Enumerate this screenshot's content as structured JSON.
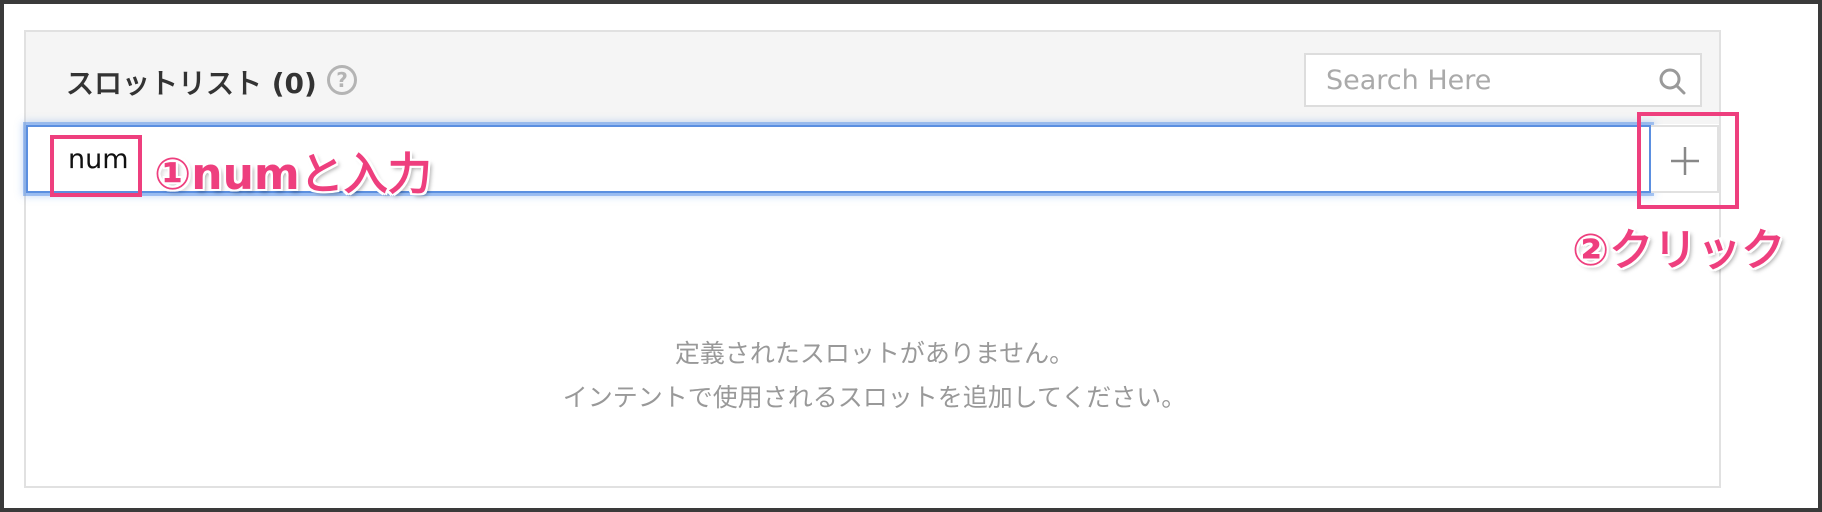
{
  "slot_list": {
    "title": "スロットリスト (0)",
    "help_icon": "question-circle-icon",
    "search": {
      "placeholder": "Search Here",
      "value": "",
      "icon": "search-icon"
    },
    "new_slot_input": {
      "value": "num",
      "placeholder": ""
    },
    "add_button": {
      "icon": "plus-icon"
    },
    "empty_message": {
      "line1": "定義されたスロットがありません。",
      "line2": "インテントで使用されるスロットを追加してください。"
    }
  },
  "annotations": {
    "step1": "①numと入力",
    "step2": "②クリック",
    "color": "#ee3f7e"
  },
  "colors": {
    "focus_ring": "#5b8fe0",
    "header_bg": "#f5f5f5",
    "muted_text": "#999999"
  }
}
